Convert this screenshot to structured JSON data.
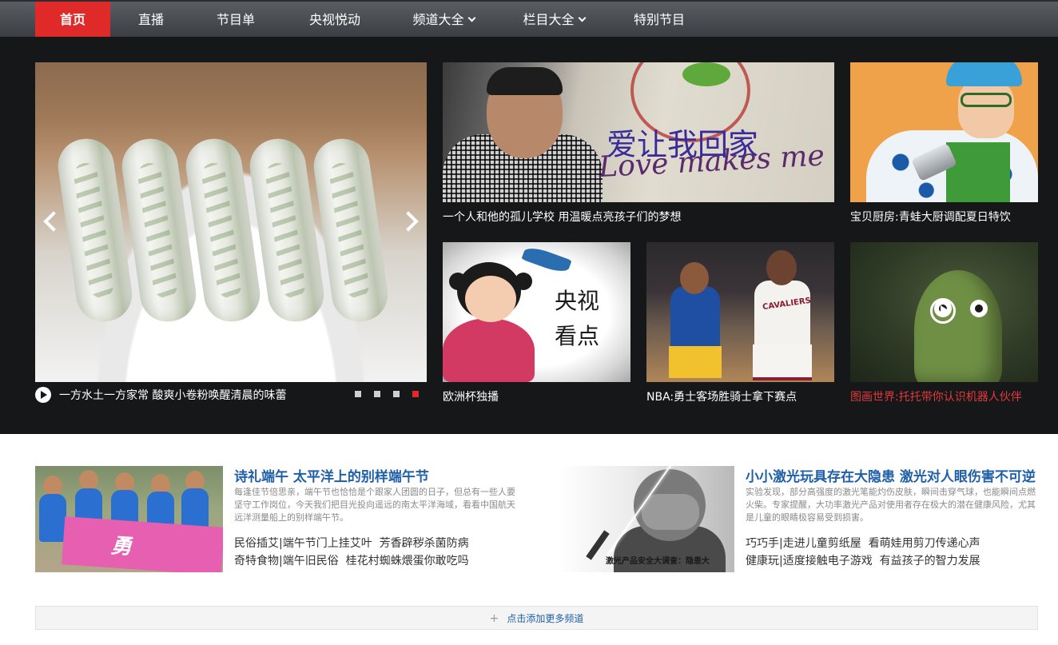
{
  "nav": {
    "items": [
      {
        "label": "首页",
        "active": true
      },
      {
        "label": "直播"
      },
      {
        "label": "节目单"
      },
      {
        "label": "央视悦动"
      },
      {
        "label": "频道大全",
        "dropdown": true
      },
      {
        "label": "栏目大全",
        "dropdown": true
      },
      {
        "label": "特别节目"
      }
    ]
  },
  "slider": {
    "caption": "一方水土一方家常 酸爽小卷粉唤醒清晨的味蕾",
    "dot_count": 4,
    "active_dot": 4
  },
  "tiles": [
    {
      "caption": "一个人和他的孤儿学校 用温暖点亮孩子们的梦想",
      "wall_text": "Love makes me a home",
      "wall_text_cn": "爱让我回家"
    },
    {
      "caption": "宝贝厨房:青蛙大厨调配夏日特饮"
    },
    {
      "caption": "欧洲杯独播",
      "art_text_1": "央视",
      "art_text_2": "看点"
    },
    {
      "caption": "NBA:勇士客场胜骑士拿下赛点",
      "jersey_text": "CAVALIERS"
    },
    {
      "caption": "图画世界:托托带你认识机器人伙伴",
      "highlight": true
    }
  ],
  "news": [
    {
      "title": "诗礼端午 太平洋上的别样端午节",
      "desc": "每逢佳节倍思亲，端午节也恰恰是个跟家人团圆的日子，但总有一些人要坚守工作岗位，今天我们把目光投向遥远的南太平洋海域，看看中国航天远洋测量船上的别样端午节。",
      "image_text": "勇",
      "links": [
        [
          "民俗插艾",
          "端午节门上挂艾叶",
          "芳香辟秽杀菌防病"
        ],
        [
          "奇特食物",
          "端午旧民俗",
          "桂花村蜘蛛煨蛋你敢吃吗"
        ]
      ]
    },
    {
      "title": "小小激光玩具存在大隐患 激光对人眼伤害不可逆",
      "desc": "实验发现，部分高强度的激光笔能灼伤皮肤，瞬间击穿气球，也能瞬间点燃火柴。专家提醒，大功率激光产品对使用者存在极大的潜在健康风险，尤其是儿童的眼睛极容易受到损害。",
      "image_text": "激光产品安全大调查：隐患大",
      "links": [
        [
          "巧巧手",
          "走进儿童剪纸屋",
          "看萌娃用剪刀传递心声"
        ],
        [
          "健康玩",
          "适度接触电子游戏",
          "有益孩子的智力发展"
        ]
      ]
    }
  ],
  "add_channel": {
    "plus": "+",
    "label": "点击添加更多频道"
  },
  "colors": {
    "nav_active": "#e02a2a",
    "dark_bg": "#161719",
    "link_blue": "#1f5fa8",
    "caption_red": "#e23a3a"
  }
}
